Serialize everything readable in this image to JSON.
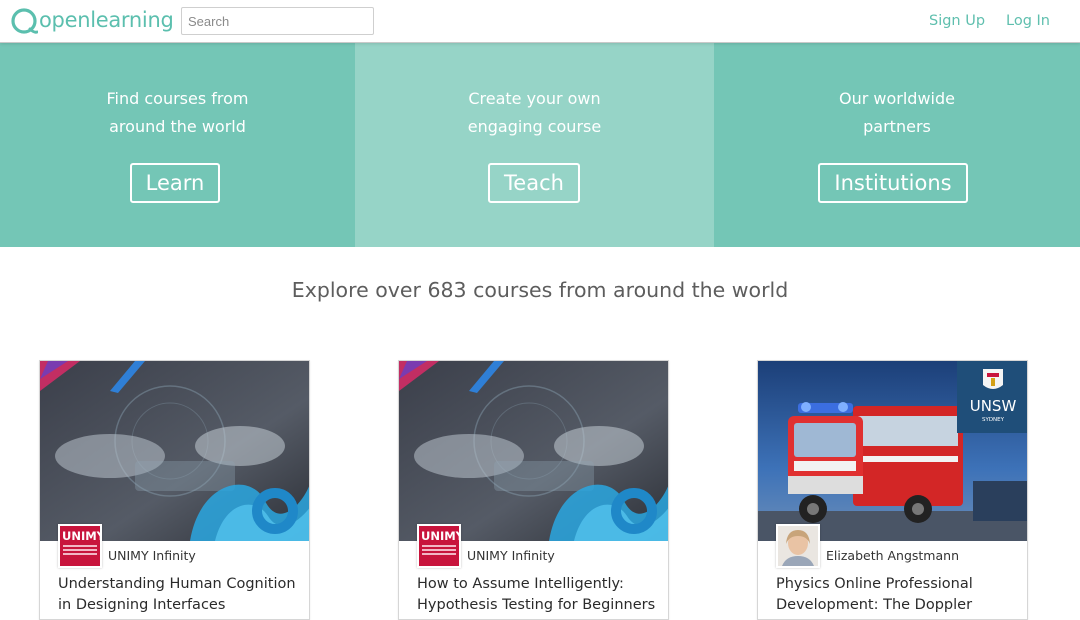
{
  "header": {
    "logo_text": "openlearning",
    "search_placeholder": "Search",
    "signup_label": "Sign Up",
    "login_label": "Log In"
  },
  "hero": {
    "panels": [
      {
        "line1": "Find courses from",
        "line2": "around the world",
        "button": "Learn",
        "color": "#74c6b6"
      },
      {
        "line1": "Create your own",
        "line2": "engaging course",
        "button": "Teach",
        "color": "#96d4c7"
      },
      {
        "line1": "Our worldwide",
        "line2": "partners",
        "button": "Institutions",
        "color": "#74c6b6"
      }
    ]
  },
  "explore_heading": "Explore over 683 courses from around the world",
  "courses": [
    {
      "provider": "UNIMY Infinity",
      "provider_logo_text": "UNIMY",
      "title": "Understanding Human Cognition in Designing Interfaces"
    },
    {
      "provider": "UNIMY Infinity",
      "provider_logo_text": "UNIMY",
      "title": "How to Assume Intelligently: Hypothesis Testing for Beginners"
    },
    {
      "provider": "Elizabeth Angstmann",
      "badge_text": "UNSW",
      "badge_sub": "SYDNEY",
      "title": "Physics Online Professional Development: The Doppler Effect"
    }
  ],
  "colors": {
    "brand": "#5bbfae",
    "hero_dark": "#74c6b6",
    "hero_light": "#96d4c7",
    "unimy_red": "#c8143c",
    "unsw_blue": "#1f4e79"
  }
}
